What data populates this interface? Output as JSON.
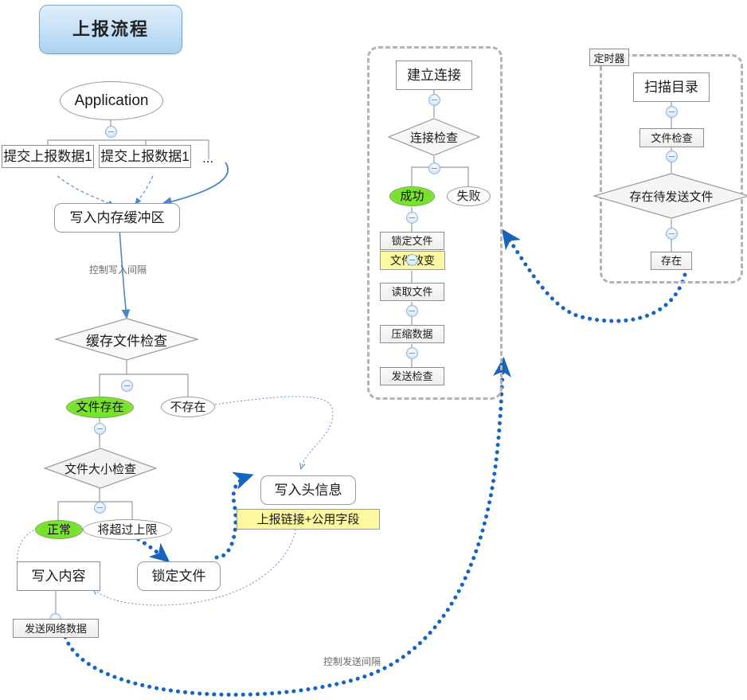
{
  "title": {
    "label": "上报流程"
  },
  "left_flow": {
    "app": "Application",
    "submit_items": [
      {
        "label": "提交上报数据1"
      },
      {
        "label": "提交上报数据1"
      }
    ],
    "ellipsis": "...",
    "write_buffer": "写入内存缓冲区",
    "edge_write_interval": "控制写入间隔",
    "cache_check": "缓存文件检查",
    "cache_yes": "文件存在",
    "cache_no": "不存在",
    "size_check": "文件大小检查",
    "size_ok": "正常",
    "size_over": "将超过上限",
    "write_content": "写入内容",
    "send_net_data": "发送网络数据",
    "lock_file": "锁定文件",
    "write_header": "写入头信息",
    "header_note": "上报链接+公用字段",
    "edge_send_interval": "控制发送间隔"
  },
  "connection_group": {
    "establish": "建立连接",
    "conn_check": "连接检查",
    "success": "成功",
    "fail": "失败",
    "lock_file": "锁定文件",
    "file_changed": "文件改变",
    "read_file": "读取文件",
    "compress": "压缩数据",
    "send_check": "发送检查"
  },
  "timer_group": {
    "tag": "定时器",
    "scan_dir": "扫描目录",
    "file_check": "文件检查",
    "has_pending": "存在待发送文件",
    "exists": "存在"
  },
  "colors": {
    "title_fill_top": "#dfeefb",
    "title_fill_bottom": "#a9d2f0",
    "title_stroke": "#7aa8cc",
    "green_fill": "#76e02c",
    "yellow_fill": "#fbf8a0",
    "node_stroke": "#9a9a9a",
    "group_dash": "#b3b3b3",
    "thin_arrow": "#4a86c8",
    "thick_arrow": "#1565c0",
    "grey_connector": "#9a9a9a",
    "edge_label_text": "#6a6a6a"
  }
}
